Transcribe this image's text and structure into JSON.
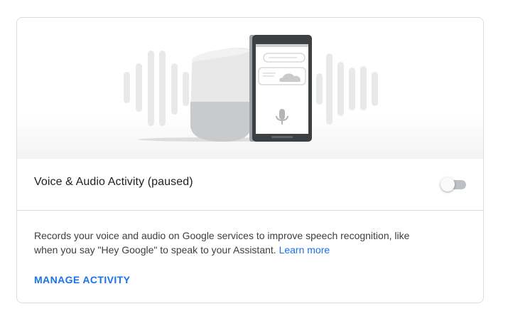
{
  "setting": {
    "title": "Voice & Audio Activity (paused)",
    "enabled": false
  },
  "description": {
    "text": "Records your voice and audio on Google services to improve speech recognition, like when you say \"Hey Google\" to speak to your Assistant. ",
    "learn_more_label": "Learn more"
  },
  "actions": {
    "manage_label": "MANAGE ACTIVITY"
  },
  "illustration": {
    "icons": [
      "sound-wave-icon",
      "smart-speaker-icon",
      "phone-icon",
      "microphone-icon",
      "cloud-icon"
    ]
  },
  "colors": {
    "link": "#1a73e8",
    "text_primary": "#202124",
    "text_secondary": "#3c4043",
    "border": "#dadce0",
    "toggle_off_track": "#bdc1c6"
  }
}
